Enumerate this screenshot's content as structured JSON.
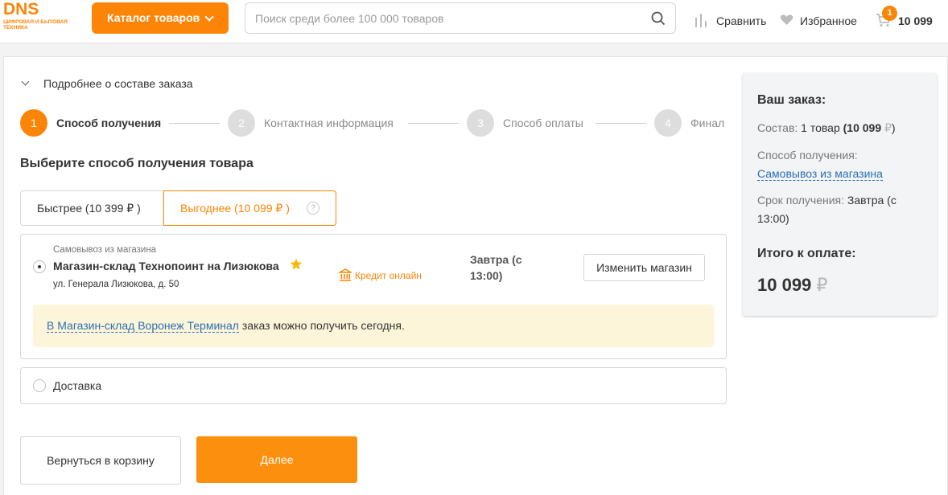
{
  "header": {
    "logo_main": "DNS",
    "logo_sub": "Цифровая и бытовая техника",
    "catalog_label": "Каталог товаров",
    "search_placeholder": "Поиск среди более 100 000 товаров",
    "compare_label": "Сравнить",
    "favorites_label": "Избранное",
    "cart_count": "1",
    "cart_total": "10 099",
    "icons": {
      "search": "search-icon",
      "compare": "compare-icon",
      "favorites": "heart-icon",
      "cart": "cart-icon",
      "catalog": "chevron-down-icon"
    }
  },
  "order": {
    "details_toggle": "Подробнее о составе заказа",
    "steps": [
      {
        "num": "1",
        "label": "Способ получения",
        "active": true
      },
      {
        "num": "2",
        "label": "Контактная информация",
        "active": false
      },
      {
        "num": "3",
        "label": "Способ оплаты",
        "active": false
      },
      {
        "num": "4",
        "label": "Финал",
        "active": false
      }
    ],
    "section_title": "Выберите способ получения товара",
    "tabs": {
      "fast": "Быстрее (10 399  ₽ )",
      "cheap": "Выгоднее (10 099  ₽ )",
      "help": "?"
    },
    "pickup": {
      "type": "Самовывоз из магазина",
      "store_name": "Магазин-склад Технопоинт на Лизюкова",
      "address": "ул. Генерала Лизюкова, д. 50",
      "credit_label": "Кредит онлайн",
      "date": "Завтра (с 13:00)",
      "change_button": "Изменить магазин",
      "notice_link": "В Магазин-склад Воронеж Терминал",
      "notice_text": " заказ можно получить сегодня."
    },
    "delivery_label": "Доставка",
    "back_button": "Вернуться в корзину",
    "next_button": "Далее"
  },
  "summary": {
    "title": "Ваш заказ:",
    "composition_label": "Состав:",
    "composition_value": "1 товар",
    "composition_price": "(10 099",
    "composition_end": ")",
    "method_label": "Способ получения:",
    "method_value": "Самовывоз из магазина",
    "term_label": "Срок получения:",
    "term_value": "Завтра (с 13:00)",
    "total_label": "Итого к оплате:",
    "total_value": "10 099",
    "currency": "₽"
  },
  "colors": {
    "accent": "#fc8507",
    "link": "#2b6fb6",
    "notice_bg": "#fdf5d9"
  }
}
